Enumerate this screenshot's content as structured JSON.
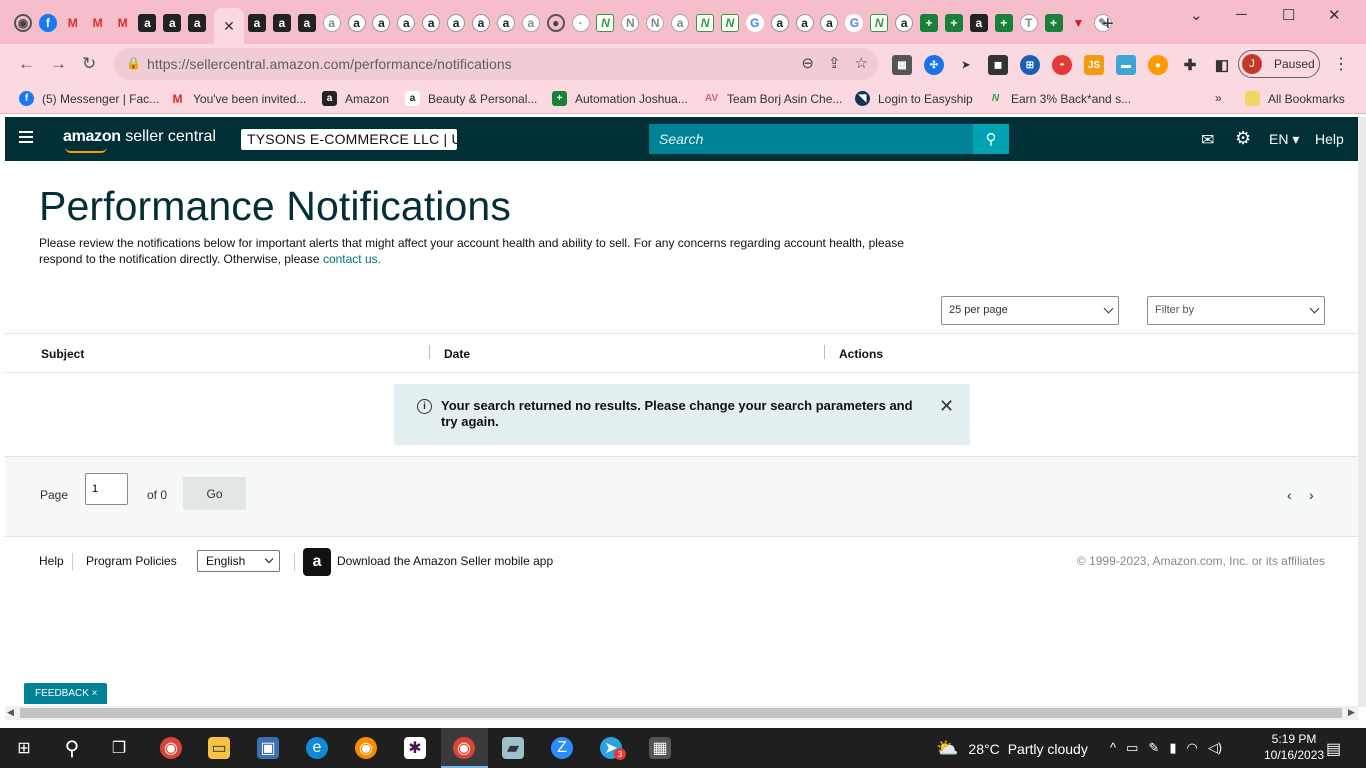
{
  "browser": {
    "active_tab_close": "✕",
    "new_tab": "+",
    "window": {
      "minimize": "─",
      "maximize": "☐",
      "close": "✕",
      "tabsearch": "⌄"
    },
    "url": "https://sellercentral.amazon.com/performance/notifications",
    "profile_initial": "J",
    "profile_status": "Paused",
    "bookmarks": [
      {
        "label": "(5) Messenger | Fac...",
        "icon": "facebook-icon",
        "color": "#1877f2"
      },
      {
        "label": "You've been invited...",
        "icon": "gmail-icon",
        "color": "#d93025"
      },
      {
        "label": "Amazon",
        "icon": "amazon-icon",
        "color": "#222222"
      },
      {
        "label": "Beauty & Personal...",
        "icon": "amazon-icon",
        "color": "#222222"
      },
      {
        "label": "Automation Joshua...",
        "icon": "sheets-icon",
        "color": "#188038"
      },
      {
        "label": "Team Borj Asin Che...",
        "icon": "team-icon",
        "color": "#cc6677"
      },
      {
        "label": "Login to Easyship",
        "icon": "easyship-icon",
        "color": "#123456"
      },
      {
        "label": "Earn 3% Back*and s...",
        "icon": "cashback-icon",
        "color": "#2e9e3a"
      }
    ],
    "bookmarks_more": "»",
    "all_bookmarks": "All Bookmarks"
  },
  "header": {
    "logo_text": "amazon",
    "logo_suffix": " seller central",
    "merchant": "TYSONS E-COMMERCE LLC | U...",
    "search_placeholder": "Search",
    "language": "EN ▾",
    "help": "Help"
  },
  "page": {
    "title": "Performance Notifications",
    "intro": "Please review the notifications below for important alerts that might affect your account health and ability to sell. For any concerns regarding account health, please respond to the notification directly. Otherwise, please ",
    "contact_link": "contact us.",
    "per_page": "25 per page",
    "filter_by": "Filter by",
    "columns": [
      "Subject",
      "Date",
      "Actions"
    ],
    "alert": "Your search returned no results. Please change your search parameters and try again.",
    "pager": {
      "page_label": "Page",
      "page_value": "1",
      "of_label": "of 0",
      "go": "Go",
      "prev": "‹",
      "next": "›"
    }
  },
  "footer": {
    "help": "Help",
    "program_policies": "Program Policies",
    "language": "English",
    "app_link": "Download the Amazon Seller mobile app",
    "copyright": "© 1999-2023, Amazon.com, Inc. or its affiliates"
  },
  "feedback": "FEEDBACK ×",
  "taskbar": {
    "temperature": "28°C",
    "weather": "Partly cloudy",
    "time": "5:19 PM",
    "date": "10/16/2023",
    "telegram_badge": "3"
  },
  "colors": {
    "header_bg": "#002f36",
    "accent": "#008296",
    "tabstrip": "#f6bdcb"
  }
}
